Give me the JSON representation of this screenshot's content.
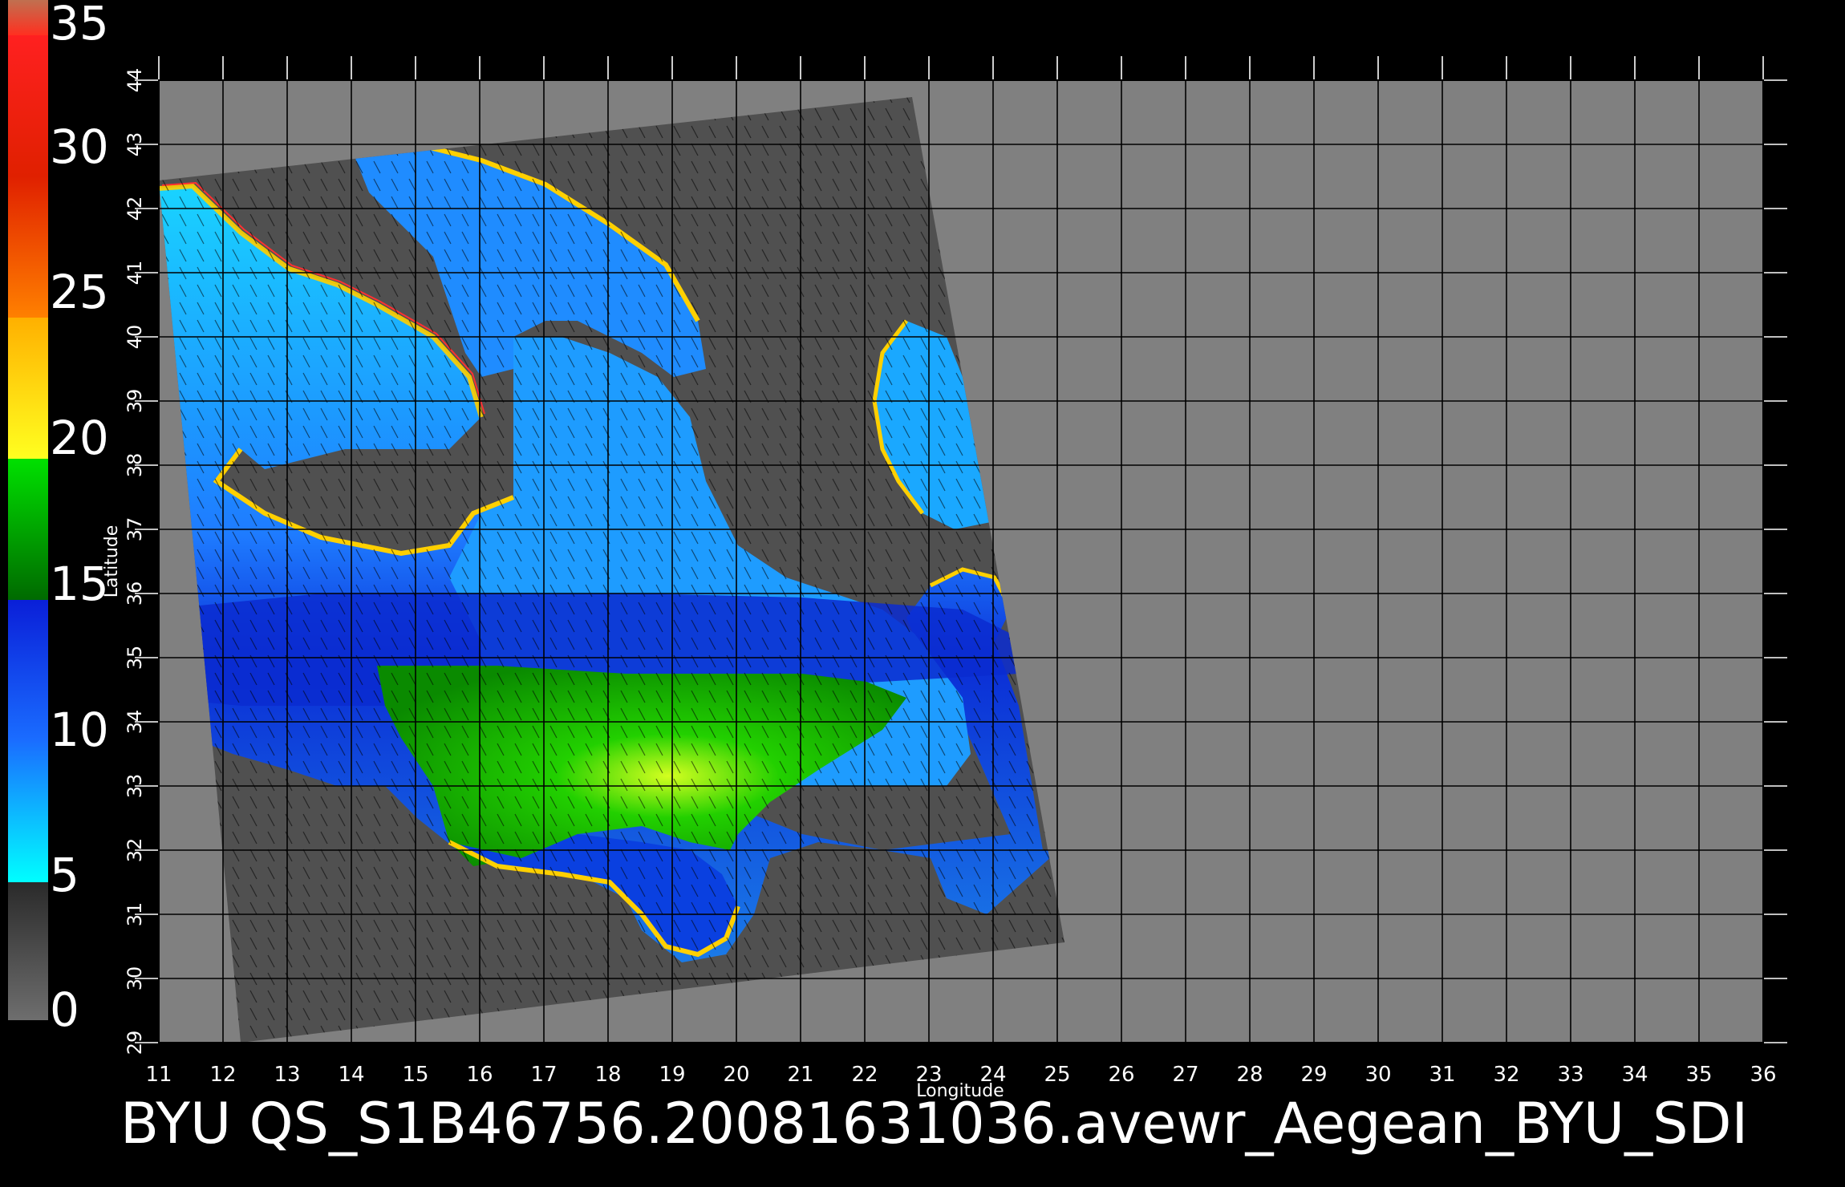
{
  "caption": "BYU  QS_S1B46756.20081631036.avewr_Aegean_BYU_SDI",
  "axes": {
    "xlabel": "Longitude",
    "ylabel": "Latitude",
    "xlim": [
      11,
      36
    ],
    "ylim": [
      29,
      44
    ],
    "xticks": [
      "11",
      "12",
      "13",
      "14",
      "15",
      "16",
      "17",
      "18",
      "19",
      "20",
      "21",
      "22",
      "23",
      "24",
      "25",
      "26",
      "27",
      "28",
      "29",
      "30",
      "31",
      "32",
      "33",
      "34",
      "35",
      "36"
    ],
    "yticks": [
      "29",
      "30",
      "31",
      "32",
      "33",
      "34",
      "35",
      "36",
      "37",
      "38",
      "39",
      "40",
      "41",
      "42",
      "43",
      "44"
    ]
  },
  "colorbar": {
    "labels": [
      "0",
      "5",
      "10",
      "15",
      "20",
      "25",
      "30",
      "35"
    ],
    "range": [
      0,
      35
    ],
    "colors": {
      "0_5": [
        "#6e6e6e",
        "#2a2a2a"
      ],
      "5_15": [
        "#00ffff",
        "#0a1fd8"
      ],
      "15_20": [
        "#006a00",
        "#00e000"
      ],
      "20_25": [
        "#ffff20",
        "#ffb000"
      ],
      "25_32": [
        "#ff8000",
        "#e02000"
      ],
      "32_35": [
        "#ff2020",
        "#c07050"
      ]
    }
  },
  "colors": {
    "background": "#000000",
    "plot_background": "#808080",
    "swath_land": "#505050",
    "grid": "#000000",
    "text": "#ffffff"
  }
}
